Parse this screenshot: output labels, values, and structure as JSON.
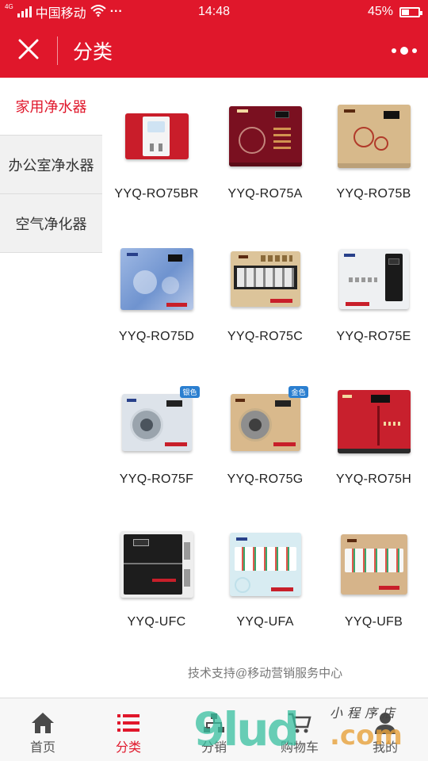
{
  "status_bar": {
    "network_badge": "4G",
    "carrier": "中国移动",
    "dots": "···",
    "time": "14:48",
    "battery_percent": "45%",
    "battery_level": 0.45
  },
  "title_bar": {
    "title": "分类"
  },
  "sidebar": {
    "items": [
      {
        "label": "家用净水器",
        "active": true
      },
      {
        "label": "办公室净水器",
        "active": false
      },
      {
        "label": "空气净化器",
        "active": false
      }
    ]
  },
  "products": [
    {
      "name": "YYQ-RO75BR",
      "body_color": "#c91d2a",
      "tag": ""
    },
    {
      "name": "YYQ-RO75A",
      "body_color": "#7a1020",
      "tag": ""
    },
    {
      "name": "YYQ-RO75B",
      "body_color": "#d7b98b",
      "tag": ""
    },
    {
      "name": "YYQ-RO75D",
      "body_color": "#6f93cf",
      "tag": ""
    },
    {
      "name": "YYQ-RO75C",
      "body_color": "#dcc49a",
      "tag": ""
    },
    {
      "name": "YYQ-RO75E",
      "body_color": "#e9ecef",
      "tag": ""
    },
    {
      "name": "YYQ-RO75F",
      "body_color": "#dde3ea",
      "tag": "银色"
    },
    {
      "name": "YYQ-RO75G",
      "body_color": "#d9b98c",
      "tag": "金色"
    },
    {
      "name": "YYQ-RO75H",
      "body_color": "#c8202d",
      "tag": ""
    },
    {
      "name": "YYQ-UFC",
      "body_color": "#222222",
      "tag": ""
    },
    {
      "name": "YYQ-UFA",
      "body_color": "#d8ecf2",
      "tag": ""
    },
    {
      "name": "YYQ-UFB",
      "body_color": "#d6b48a",
      "tag": ""
    }
  ],
  "footer_note": "技术支持@移动营销服务中心",
  "tab_bar": {
    "tabs": [
      {
        "label": "首页",
        "icon": "home-icon",
        "active": false
      },
      {
        "label": "分类",
        "icon": "list-icon",
        "active": true
      },
      {
        "label": "分销",
        "icon": "share-network-icon",
        "active": false
      },
      {
        "label": "购物车",
        "icon": "cart-icon",
        "active": false
      },
      {
        "label": "我的",
        "icon": "user-icon",
        "active": false
      }
    ]
  },
  "watermark": {
    "number": "9lud",
    "suffix": ".com",
    "caption": "小程序店"
  },
  "colors": {
    "brand_red": "#e0172b",
    "sidebar_bg": "#f1f1f1",
    "tab_bg": "#f7f7f7"
  }
}
